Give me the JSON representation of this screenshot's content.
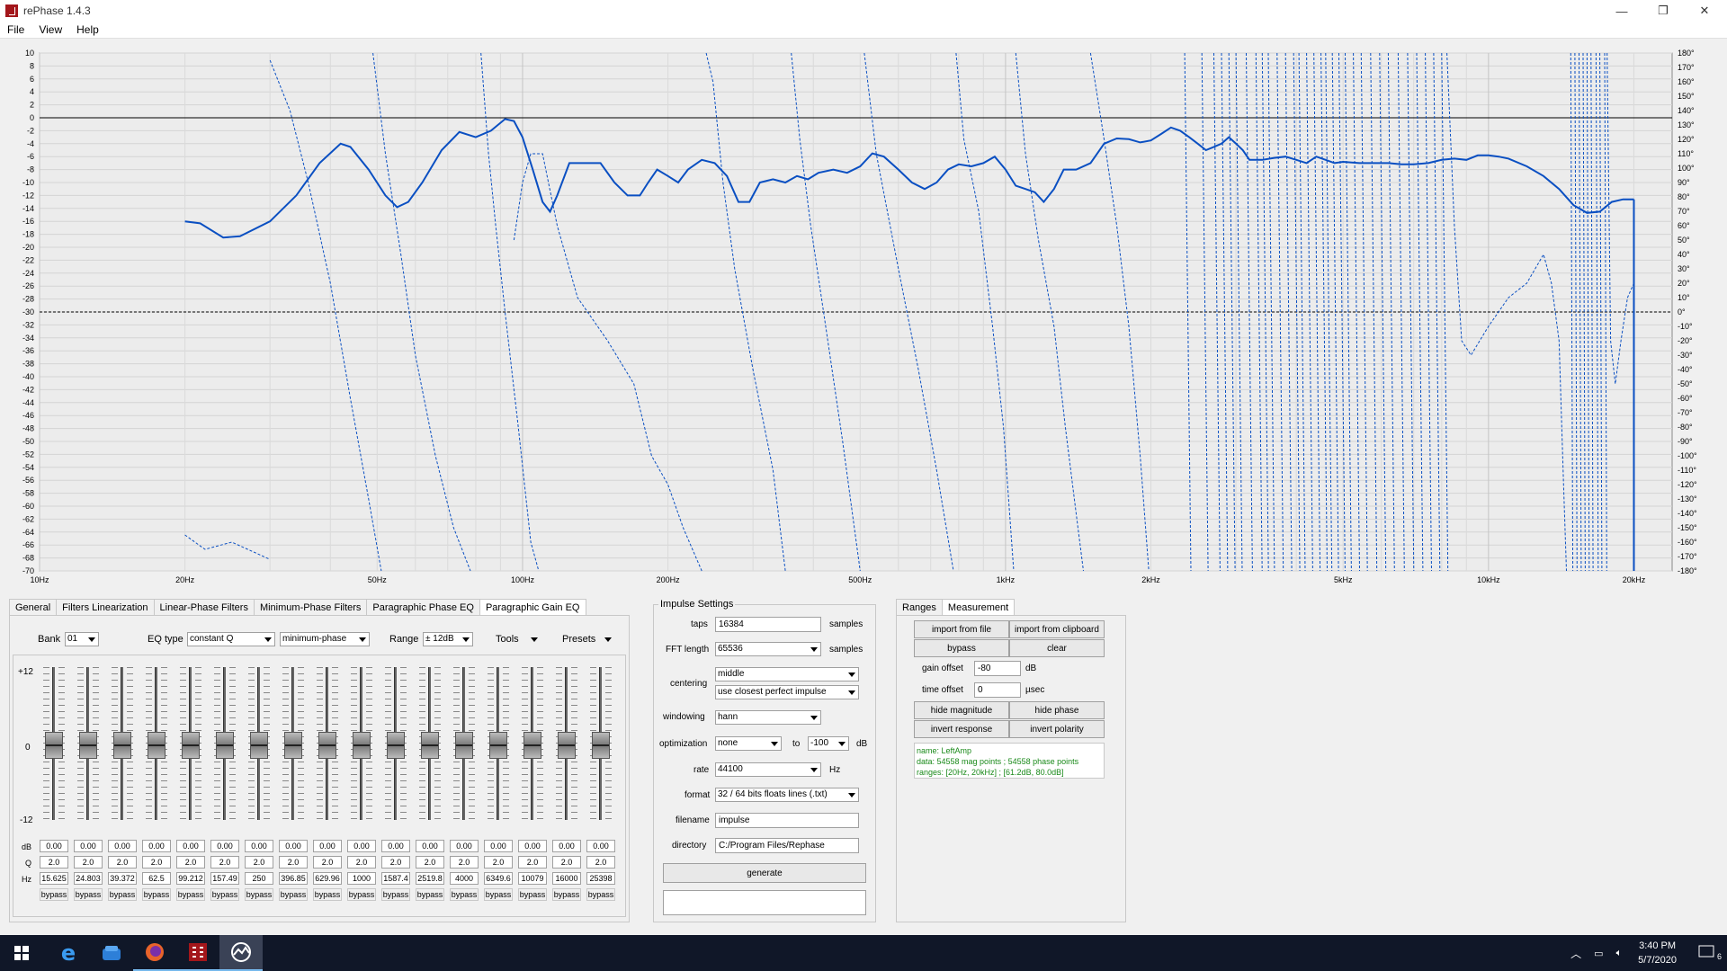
{
  "window": {
    "title": "rePhase 1.4.3",
    "minimize": "—",
    "maximize": "❐",
    "close": "✕"
  },
  "menu": [
    "File",
    "View",
    "Help"
  ],
  "plot": {
    "left_ticks": [
      "10",
      "8",
      "6",
      "4",
      "2",
      "0",
      "-2",
      "-4",
      "-6",
      "-8",
      "-10",
      "-12",
      "-14",
      "-16",
      "-18",
      "-20",
      "-22",
      "-24",
      "-26",
      "-28",
      "-30",
      "-32",
      "-34",
      "-36",
      "-38",
      "-40",
      "-42",
      "-44",
      "-46",
      "-48",
      "-50",
      "-52",
      "-54",
      "-56",
      "-58",
      "-60",
      "-62",
      "-64",
      "-66",
      "-68",
      "-70"
    ],
    "right_ticks": [
      "180°",
      "170°",
      "160°",
      "150°",
      "140°",
      "130°",
      "120°",
      "110°",
      "100°",
      "90°",
      "80°",
      "70°",
      "60°",
      "50°",
      "40°",
      "30°",
      "20°",
      "10°",
      "0°",
      "-10°",
      "-20°",
      "-30°",
      "-40°",
      "-50°",
      "-60°",
      "-70°",
      "-80°",
      "-90°",
      "-100°",
      "-110°",
      "-120°",
      "-130°",
      "-140°",
      "-150°",
      "-160°",
      "-170°",
      "-180°"
    ],
    "freq_labels": [
      {
        "f": 10,
        "label": "10Hz"
      },
      {
        "f": 20,
        "label": "20Hz"
      },
      {
        "f": 50,
        "label": "50Hz"
      },
      {
        "f": 100,
        "label": "100Hz"
      },
      {
        "f": 200,
        "label": "200Hz"
      },
      {
        "f": 500,
        "label": "500Hz"
      },
      {
        "f": 1000,
        "label": "1kHz"
      },
      {
        "f": 2000,
        "label": "2kHz"
      },
      {
        "f": 5000,
        "label": "5kHz"
      },
      {
        "f": 10000,
        "label": "10kHz"
      },
      {
        "f": 20000,
        "label": "20kHz"
      }
    ],
    "line_color": "#0a4fc2"
  },
  "tabs": [
    "General",
    "Filters Linearization",
    "Linear-Phase Filters",
    "Minimum-Phase Filters",
    "Paragraphic Phase EQ",
    "Paragraphic Gain EQ"
  ],
  "active_tab": 5,
  "eq": {
    "bank_label": "Bank",
    "bank_value": "01",
    "eqtype_label": "EQ type",
    "eqtype_value": "constant Q",
    "phase_value": "minimum-phase",
    "range_label": "Range",
    "range_value": "± 12dB",
    "tools_label": "Tools",
    "presets_label": "Presets",
    "scale_top": "+12",
    "scale_mid": "0",
    "scale_bot": "-12",
    "row_db": "dB",
    "row_q": "Q",
    "row_hz": "Hz",
    "bands": [
      {
        "db": "0.00",
        "q": "2.0",
        "hz": "15.625",
        "bypass": "bypass"
      },
      {
        "db": "0.00",
        "q": "2.0",
        "hz": "24.803",
        "bypass": "bypass"
      },
      {
        "db": "0.00",
        "q": "2.0",
        "hz": "39.372",
        "bypass": "bypass"
      },
      {
        "db": "0.00",
        "q": "2.0",
        "hz": "62.5",
        "bypass": "bypass"
      },
      {
        "db": "0.00",
        "q": "2.0",
        "hz": "99.212",
        "bypass": "bypass"
      },
      {
        "db": "0.00",
        "q": "2.0",
        "hz": "157.49",
        "bypass": "bypass"
      },
      {
        "db": "0.00",
        "q": "2.0",
        "hz": "250",
        "bypass": "bypass"
      },
      {
        "db": "0.00",
        "q": "2.0",
        "hz": "396.85",
        "bypass": "bypass"
      },
      {
        "db": "0.00",
        "q": "2.0",
        "hz": "629.96",
        "bypass": "bypass"
      },
      {
        "db": "0.00",
        "q": "2.0",
        "hz": "1000",
        "bypass": "bypass"
      },
      {
        "db": "0.00",
        "q": "2.0",
        "hz": "1587.4",
        "bypass": "bypass"
      },
      {
        "db": "0.00",
        "q": "2.0",
        "hz": "2519.8",
        "bypass": "bypass"
      },
      {
        "db": "0.00",
        "q": "2.0",
        "hz": "4000",
        "bypass": "bypass"
      },
      {
        "db": "0.00",
        "q": "2.0",
        "hz": "6349.6",
        "bypass": "bypass"
      },
      {
        "db": "0.00",
        "q": "2.0",
        "hz": "10079",
        "bypass": "bypass"
      },
      {
        "db": "0.00",
        "q": "2.0",
        "hz": "16000",
        "bypass": "bypass"
      },
      {
        "db": "0.00",
        "q": "2.0",
        "hz": "25398",
        "bypass": "bypass"
      }
    ]
  },
  "impulse": {
    "title": "Impulse Settings",
    "taps_label": "taps",
    "taps_value": "16384",
    "taps_unit": "samples",
    "fft_label": "FFT length",
    "fft_value": "65536",
    "fft_unit": "samples",
    "centering_label": "centering",
    "centering_value": "middle",
    "centering_mode": "use closest perfect impulse",
    "windowing_label": "windowing",
    "windowing_value": "hann",
    "optimization_label": "optimization",
    "optimization_value": "none",
    "to_label": "to",
    "opt_db_value": "-100",
    "opt_db_unit": "dB",
    "rate_label": "rate",
    "rate_value": "44100",
    "rate_unit": "Hz",
    "format_label": "format",
    "format_value": "32 / 64 bits floats lines (.txt)",
    "filename_label": "filename",
    "filename_value": "impulse",
    "directory_label": "directory",
    "directory_value": "C:/Program Files/Rephase",
    "generate_label": "generate"
  },
  "measure": {
    "tabs": [
      "Ranges",
      "Measurement"
    ],
    "active_tab": 1,
    "import_file": "import from file",
    "import_clip": "import from clipboard",
    "bypass": "bypass",
    "clear": "clear",
    "gain_offset_label": "gain offset",
    "gain_offset_value": "-80",
    "gain_offset_unit": "dB",
    "time_offset_label": "time offset",
    "time_offset_value": "0",
    "time_offset_unit": "µsec",
    "hide_mag": "hide magnitude",
    "hide_phase": "hide phase",
    "invert_response": "invert response",
    "invert_polarity": "invert polarity",
    "info_name": "name: LeftAmp",
    "info_data": "data: 54558 mag points ; 54558 phase points",
    "info_ranges": "ranges: [20Hz, 20kHz] ; [61.2dB, 80.0dB]",
    "info_color": "#1a8a1a"
  },
  "taskbar": {
    "time": "3:40 PM",
    "date": "5/7/2020",
    "notif_count": "6"
  }
}
